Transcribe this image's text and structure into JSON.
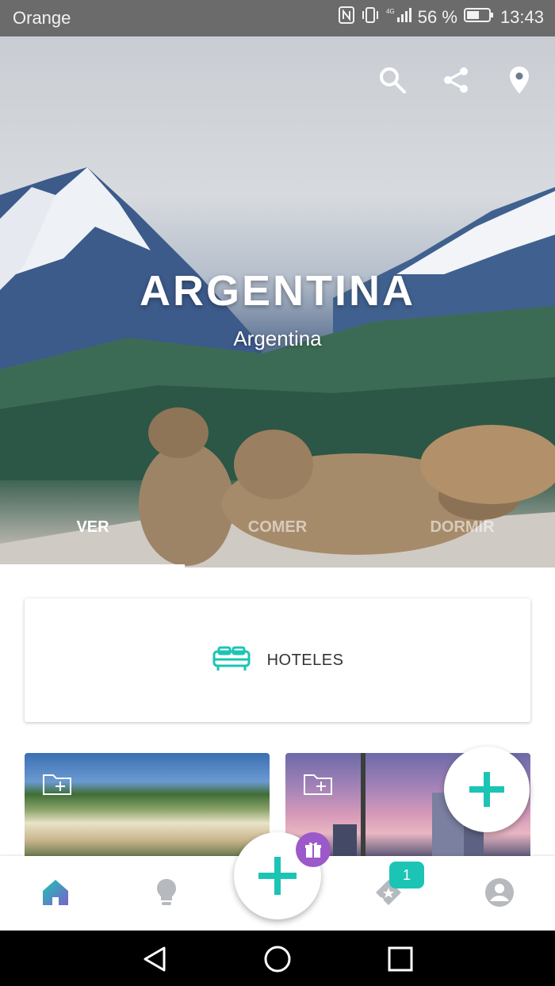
{
  "status_bar": {
    "carrier": "Orange",
    "battery": "56 %",
    "time": "13:43"
  },
  "hero": {
    "title": "ARGENTINA",
    "subtitle": "Argentina",
    "actions": [
      "search-icon",
      "share-icon",
      "location-pin-icon"
    ]
  },
  "tabs": [
    {
      "label": "VER",
      "active": true
    },
    {
      "label": "COMER",
      "active": false
    },
    {
      "label": "DORMIR",
      "active": false
    }
  ],
  "hotels_card": {
    "icon": "bed-icon",
    "label": "HOTELES"
  },
  "bottom_nav": {
    "items": [
      "home-icon",
      "lightbulb-icon",
      "add-icon",
      "ticket-star-icon",
      "account-icon"
    ],
    "ticket_badge": "1"
  },
  "colors": {
    "accent": "#1cc4b5",
    "gift": "#9c59c9",
    "status_bar": "#6b6b6b"
  }
}
